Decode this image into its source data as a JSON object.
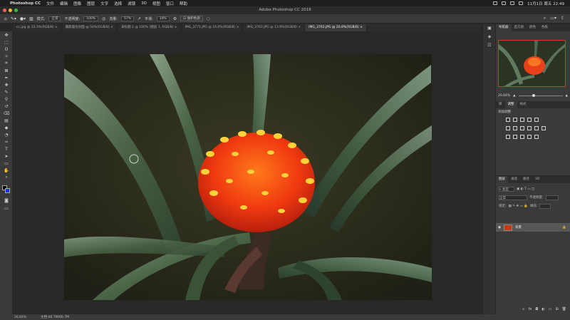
{
  "menubar": {
    "app_name": "Photoshop CC",
    "menus": [
      "文件",
      "编辑",
      "图像",
      "图层",
      "文字",
      "选择",
      "滤镜",
      "3D",
      "视图",
      "窗口",
      "帮助"
    ],
    "clock": "11月1日 周五 22:49"
  },
  "window": {
    "title": "Adobe Photoshop CC 2019"
  },
  "options": {
    "mode_label": "模式:",
    "mode_value": "正常",
    "opacity_label": "不透明度:",
    "opacity_value": "100%",
    "flow_label": "流量:",
    "flow_value": "57%",
    "smoothing_label": "平滑:",
    "smoothing_value": "10%",
    "protect_label": "保护色调"
  },
  "tabs": [
    {
      "label": "cc.jpg @ 33.3%(RGB/8) ×",
      "active": false
    },
    {
      "label": "摄影器份封面 @ 50%(RGB/8) ×",
      "active": false
    },
    {
      "label": "未标题-1 @ 100% (图层 1, RGB/8) ×",
      "active": false
    },
    {
      "label": "IMG_3771.JPG @ 16.6%(RGB/8) ×",
      "active": false
    },
    {
      "label": "IMG_3763.JPG @ 13.9%(RGB/8) ×",
      "active": false
    },
    {
      "label": "IMG_3762.JPG @ 20.8%(RGB/8) ×",
      "active": true
    }
  ],
  "tools": [
    "move",
    "marquee",
    "lasso",
    "quick-select",
    "crop",
    "frame",
    "eyedropper",
    "heal",
    "brush",
    "stamp",
    "history-brush",
    "eraser",
    "gradient",
    "blur",
    "dodge",
    "pen",
    "type",
    "path-select",
    "rectangle",
    "hand",
    "zoom"
  ],
  "status": {
    "zoom": "20.84%",
    "doc": "文档:66.7M/66.7M"
  },
  "navigator": {
    "tabs": [
      "导航器",
      "直方图",
      "颜色",
      "色板"
    ],
    "zoom_value": "20.84%",
    "zoom_level": 0.32
  },
  "adjustments": {
    "title": "添加调整"
  },
  "layers": {
    "tabs": [
      "图层",
      "通道",
      "路径",
      "3D"
    ],
    "kind_label": "类型",
    "blend_mode": "正常",
    "opacity_label": "不透明度:",
    "lock_label": "锁定:",
    "fill_label": "填充:",
    "layer_name": "背景"
  }
}
